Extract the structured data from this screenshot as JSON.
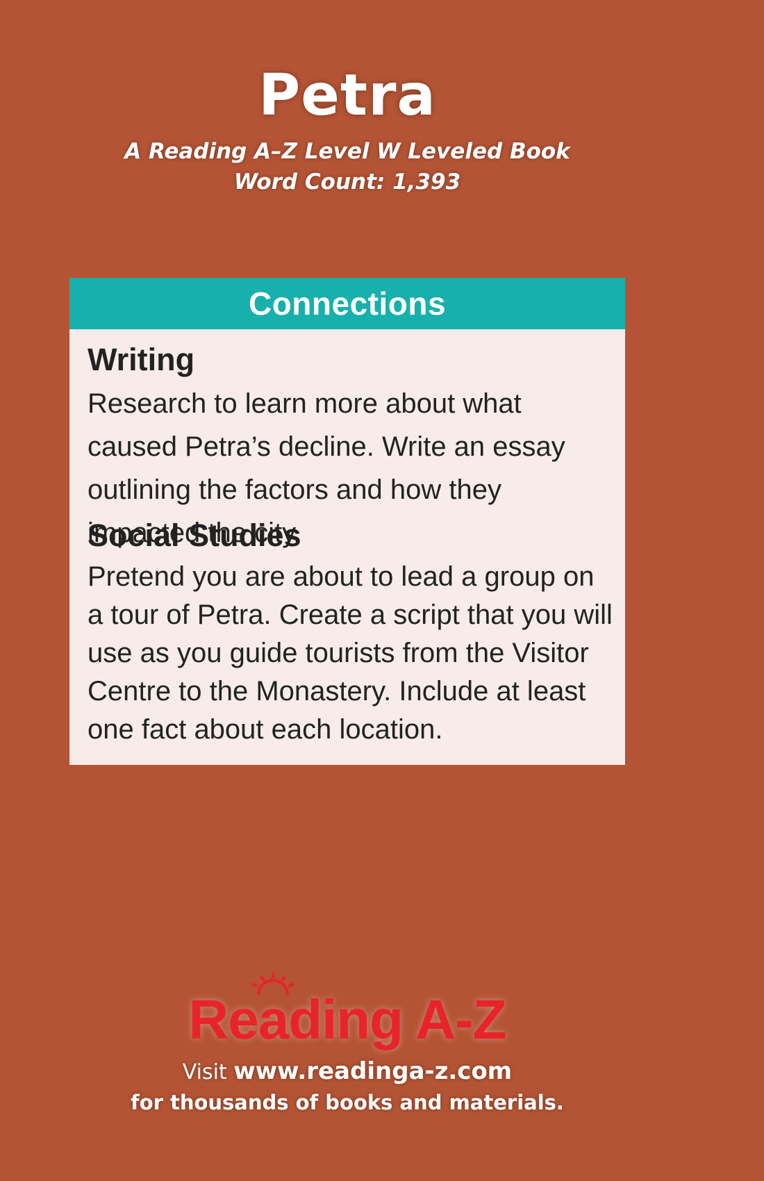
{
  "cover": {
    "title": "Petra",
    "level_line": "A Reading A–Z Level W Leveled Book",
    "word_count_line": "Word Count: 1,393"
  },
  "connections": {
    "header": "Connections",
    "sections": [
      {
        "heading": "Writing",
        "body": "Research to learn more about what caused Petra’s decline. Write an essay outlining the factors and how they impacted the city."
      },
      {
        "heading": "Social Studies",
        "body": "Pretend you are about to lead a group on a tour of Petra. Create a script that you will use as you guide tourists from the Visitor Centre to the Monastery. Include at least one fact about each location."
      }
    ]
  },
  "footer": {
    "logo_text": "Reading A-Z",
    "visit_word": "Visit",
    "url": "www.readinga-z.com",
    "tagline": "for thousands of books and materials."
  },
  "colors": {
    "background": "#b45434",
    "header_bar": "#18b0ac",
    "panel": "#f7ecea",
    "logo": "#e8232a"
  }
}
